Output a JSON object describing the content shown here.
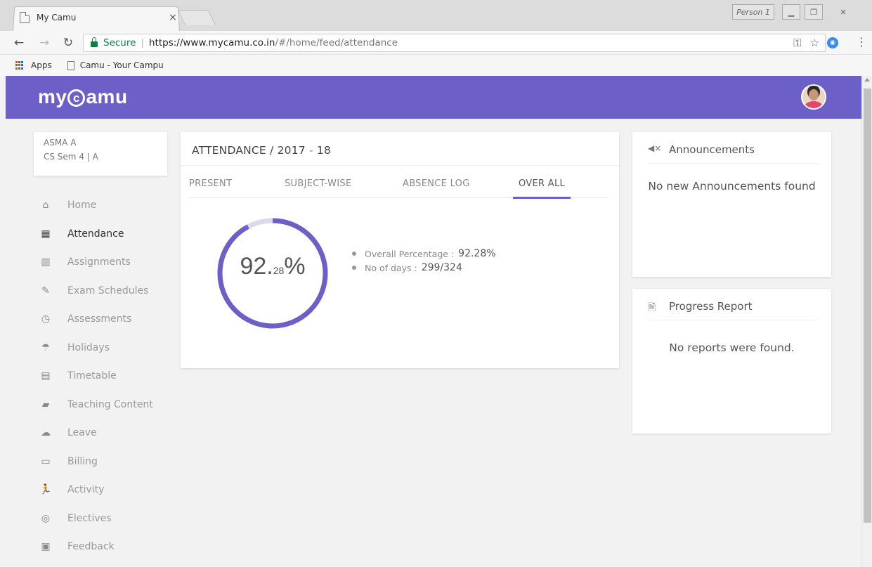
{
  "browser": {
    "tab_title": "My Camu",
    "tab_close": "×",
    "profile": "Person 1",
    "secure_label": "Secure",
    "url_host": "https://www.mycamu.co.in",
    "url_path": "/#/home/feed/attendance",
    "bookmarks": [
      {
        "label": "Apps"
      },
      {
        "label": "Camu - Your Campu"
      }
    ]
  },
  "app": {
    "logo_prefix": "my",
    "logo_c": "c",
    "logo_suffix": "amu"
  },
  "user": {
    "name": "ASMA A",
    "class": "CS Sem 4  | A"
  },
  "nav": [
    {
      "label": "Home",
      "icon": "home-icon"
    },
    {
      "label": "Attendance",
      "icon": "calendar-icon",
      "active": true
    },
    {
      "label": "Assignments",
      "icon": "books-icon"
    },
    {
      "label": "Exam Schedules",
      "icon": "exam-icon"
    },
    {
      "label": "Assessments",
      "icon": "stopwatch-icon"
    },
    {
      "label": "Holidays",
      "icon": "beach-umbrella-icon"
    },
    {
      "label": "Timetable",
      "icon": "timetable-icon"
    },
    {
      "label": "Teaching Content",
      "icon": "book-open-icon"
    },
    {
      "label": "Leave",
      "icon": "weather-icon"
    },
    {
      "label": "Billing",
      "icon": "billing-icon"
    },
    {
      "label": "Activity",
      "icon": "runner-icon"
    },
    {
      "label": "Electives",
      "icon": "target-icon"
    },
    {
      "label": "Feedback",
      "icon": "feedback-icon"
    }
  ],
  "attendance": {
    "title": "ATTENDANCE / 2017",
    "title_sep": " - ",
    "title_year_end": "18",
    "tabs": [
      "PRESENT",
      "SUBJECT-WISE",
      "ABSENCE LOG",
      "OVER ALL"
    ],
    "active_tab": 3,
    "percent_major": "92.",
    "percent_minor": "28",
    "percent_sign": "%",
    "percent_value": 92.28,
    "stats": [
      {
        "label": "Overall Percentage  :",
        "value": "92.28%"
      },
      {
        "label": "No of days  :",
        "value": "299/324"
      }
    ]
  },
  "announcements": {
    "title": "Announcements",
    "empty": "No new Announcements found"
  },
  "progress_report": {
    "title": "Progress Report",
    "empty": "No reports were found."
  },
  "colors": {
    "brand": "#6c5fc7",
    "ring_track": "#d8dbe8"
  }
}
